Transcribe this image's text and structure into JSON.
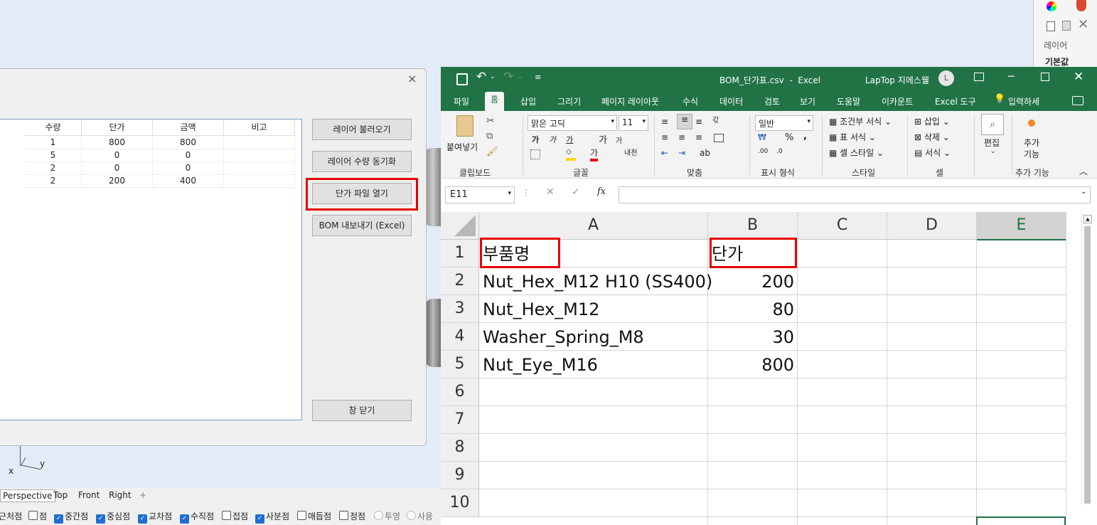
{
  "right_panel": {
    "layer_label": "레이어",
    "default_label": "기본값"
  },
  "dialog": {
    "columns": [
      "수량",
      "단가",
      "금액",
      "비고"
    ],
    "rows": [
      [
        "1",
        "800",
        "800",
        ""
      ],
      [
        "5",
        "0",
        "0",
        ""
      ],
      [
        "2",
        "0",
        "0",
        ""
      ],
      [
        "2",
        "200",
        "400",
        ""
      ]
    ],
    "buttons": {
      "load_layers": "레이어 불러오기",
      "sync_qty": "레이어 수량 동기화",
      "open_price": "단가 파일 열기",
      "export_bom": "BOM 내보내기 (Excel)",
      "close": "창 닫기"
    },
    "close_glyph": "×"
  },
  "viewport": {
    "axis_y": "y",
    "axis_x": "x",
    "tabs": [
      "Perspective",
      "Top",
      "Front",
      "Right"
    ],
    "add_tab": "+"
  },
  "osnap": [
    {
      "label": "근처점",
      "checked": false,
      "partial": true
    },
    {
      "label": "점",
      "checked": false
    },
    {
      "label": "중간점",
      "checked": true
    },
    {
      "label": "중심점",
      "checked": true
    },
    {
      "label": "교차점",
      "checked": true
    },
    {
      "label": "수직점",
      "checked": true
    },
    {
      "label": "접점",
      "checked": false
    },
    {
      "label": "사분점",
      "checked": true
    },
    {
      "label": "매듭점",
      "checked": false
    },
    {
      "label": "정점",
      "checked": false
    },
    {
      "label": "투영",
      "checked": false,
      "radio": true
    },
    {
      "label": "사용",
      "checked": false,
      "radio": true
    }
  ],
  "excel": {
    "title": "BOM_단가표.csv  -  Excel",
    "user": "LapTop 지에스웰",
    "user_initial": "L",
    "tabs": [
      "파일",
      "홈",
      "삽입",
      "그리기",
      "페이지 레이아웃",
      "수식",
      "데이터",
      "검토",
      "보기",
      "도움말",
      "이카운트",
      "Excel 도구",
      "입력하세"
    ],
    "active_tab": "홈",
    "ribbon": {
      "paste": "붙여넣기",
      "font_name": "맑은 고딕",
      "font_size": "11",
      "number_format": "일반",
      "conditional": "조건부 서식",
      "table_format": "표 서식",
      "cell_style": "셀 스타일",
      "insert": "삽입",
      "delete": "삭제",
      "format": "서식",
      "edit": "편집",
      "addins": "추가\n기능",
      "addins_label_1": "추가",
      "addins_label_2": "기능",
      "groups": [
        "클립보드",
        "글꼴",
        "맞춤",
        "표시 형식",
        "스타일",
        "셀",
        "편집",
        "추가 기능"
      ]
    },
    "name_box": "E11",
    "fx": "fx",
    "col_headers": [
      "A",
      "B",
      "C",
      "D",
      "E"
    ],
    "row_headers": [
      "1",
      "2",
      "3",
      "4",
      "5",
      "6",
      "7",
      "8",
      "9",
      "10"
    ],
    "cells": [
      {
        "a": "부품명",
        "b": "단가"
      },
      {
        "a": "Nut_Hex_M12 H10 (SS400)",
        "b": "200"
      },
      {
        "a": "Nut_Hex_M12",
        "b": "80"
      },
      {
        "a": "Washer_Spring_M8",
        "b": "30"
      },
      {
        "a": "Nut_Eye_M16",
        "b": "800"
      }
    ],
    "accent": "#217346",
    "highlight_color": "#e60000"
  }
}
